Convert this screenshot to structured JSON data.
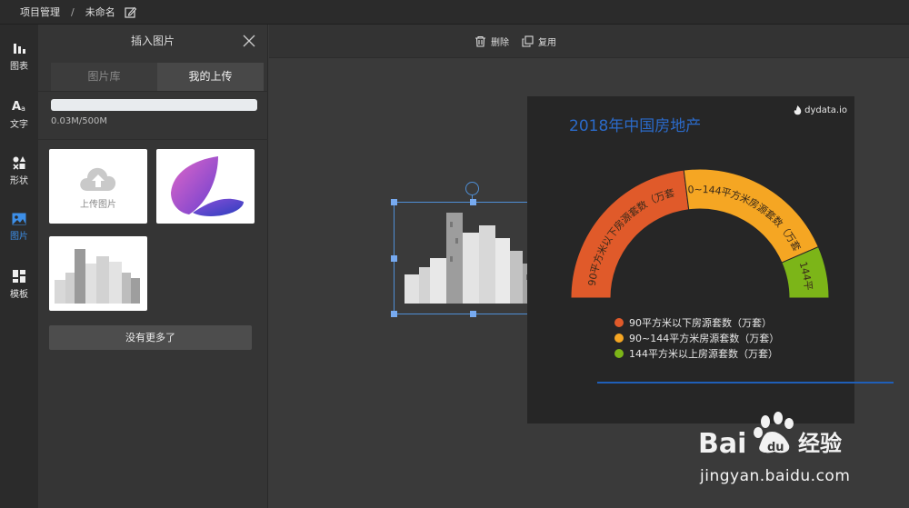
{
  "breadcrumb": {
    "project": "项目管理",
    "separator": "/",
    "name": "未命名"
  },
  "leftnav": [
    {
      "label": "图表",
      "icon": "chart-icon"
    },
    {
      "label": "文字",
      "icon": "text-icon"
    },
    {
      "label": "形状",
      "icon": "shape-icon"
    },
    {
      "label": "图片",
      "icon": "image-icon",
      "active": true
    },
    {
      "label": "模板",
      "icon": "template-icon"
    }
  ],
  "panel": {
    "title": "插入图片",
    "tabs": [
      "图片库",
      "我的上传"
    ],
    "active_tab": "我的上传",
    "storage_text": "0.03M/500M",
    "upload_label": "上传图片",
    "no_more": "没有更多了"
  },
  "toolbar": {
    "delete_label": "删除",
    "copy_label": "复用"
  },
  "card": {
    "title": "2018年中国房地产",
    "logo": "dydata.io",
    "legend": [
      {
        "label": "90平方米以下房源套数（万套）",
        "color": "#e05a2a"
      },
      {
        "label": "90~144平方米房源套数（万套）",
        "color": "#f5a623"
      },
      {
        "label": "144平方米以上房源套数（万套）",
        "color": "#7cb518"
      }
    ],
    "arc_labels": [
      "90平方米以下房源套数（万套",
      "90~144平方米房源套数（万套）",
      "144平"
    ]
  },
  "chart_data": {
    "type": "pie",
    "title": "2018年中国房地产",
    "categories": [
      "90平方米以下房源套数（万套）",
      "90~144平方米房源套数（万套）",
      "144平方米以上房源套数（万套）"
    ],
    "values": [
      46,
      41,
      13
    ],
    "colors": [
      "#e05a2a",
      "#f5a623",
      "#7cb518"
    ],
    "legend": "bottom"
  },
  "watermark": {
    "text": "Bai经验",
    "url": "jingyan.baidu.com"
  }
}
